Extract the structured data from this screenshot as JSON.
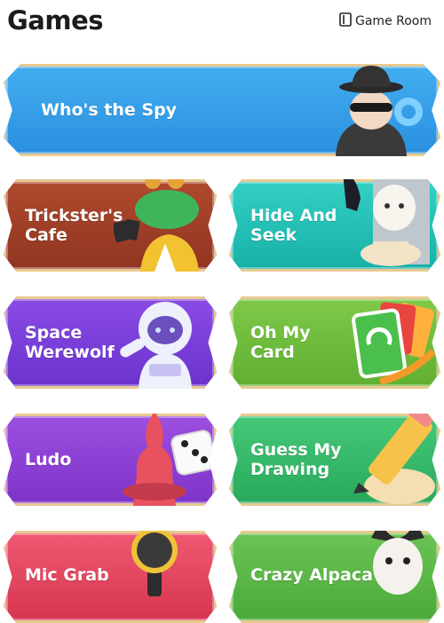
{
  "header": {
    "title": "Games",
    "room_label": "Game Room"
  },
  "games": [
    {
      "label": "Who's the Spy",
      "color": "#2f9be8"
    },
    {
      "label": "Trickster's\nCafe",
      "color": "#9e3b25"
    },
    {
      "label": "Hide And\nSeek",
      "color": "#22c3b8"
    },
    {
      "label": "Space\nWerewolf",
      "color": "#7a3ed8"
    },
    {
      "label": "Oh My\nCard",
      "color": "#6fbe3c"
    },
    {
      "label": "Ludo",
      "color": "#8e3fd4"
    },
    {
      "label": "Guess My\nDrawing",
      "color": "#37b96a"
    },
    {
      "label": "Mic Grab",
      "color": "#e3405a"
    },
    {
      "label": "Crazy Alpaca",
      "color": "#59b547"
    }
  ]
}
